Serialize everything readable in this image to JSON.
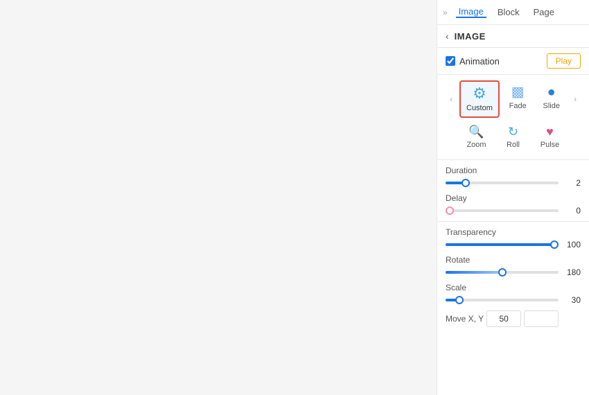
{
  "panel": {
    "tabs": [
      {
        "label": "Image",
        "active": true
      },
      {
        "label": "Block",
        "active": false
      },
      {
        "label": "Page",
        "active": false
      }
    ],
    "expand_icon": "»",
    "back_icon": "‹",
    "section_title": "IMAGE",
    "animation_label": "Animation",
    "play_button": "Play",
    "animation_items_row1": [
      {
        "id": "custom",
        "label": "Custom",
        "icon": "⚙",
        "selected": true
      },
      {
        "id": "fade",
        "label": "Fade",
        "icon": "▩",
        "selected": false
      },
      {
        "id": "slide",
        "label": "Slide",
        "icon": "●",
        "selected": false
      }
    ],
    "animation_items_row2": [
      {
        "id": "zoom",
        "label": "Zoom",
        "icon": "🔍",
        "selected": false
      },
      {
        "id": "roll",
        "label": "Roll",
        "icon": "↻",
        "selected": false
      },
      {
        "id": "pulse",
        "label": "Pulse",
        "icon": "♥",
        "selected": false
      }
    ],
    "sliders": [
      {
        "label": "Duration",
        "value": 2,
        "fill_pct": 18,
        "fill_color": "#1a73e8",
        "thumb_color": "#1a73e8"
      },
      {
        "label": "Delay",
        "value": 0,
        "fill_pct": 0,
        "fill_color": "#f48fb1",
        "thumb_color": "#f48fb1"
      }
    ],
    "custom_sliders": [
      {
        "label": "Transparency",
        "value": 100,
        "fill_pct": 100,
        "fill_color": "#1a73e8",
        "thumb_color": "#1a73e8"
      },
      {
        "label": "Rotate",
        "value": 180,
        "fill_pct": 50,
        "fill_color": "#1a73e8",
        "thumb_color": "#1a73e8"
      },
      {
        "label": "Scale",
        "value": 30,
        "fill_pct": 12,
        "fill_color": "#1a73e8",
        "thumb_color": "#1a73e8"
      }
    ],
    "move_label": "Move X, Y",
    "move_x": "50",
    "move_y": ""
  }
}
